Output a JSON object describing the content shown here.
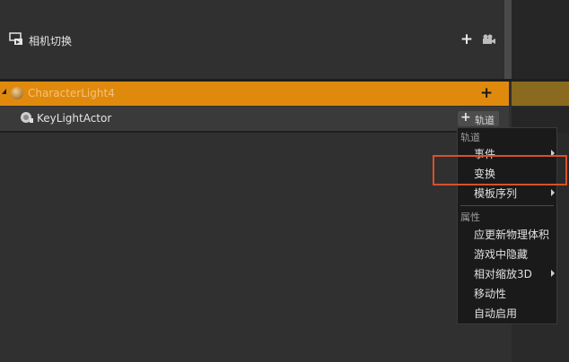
{
  "outliner": {
    "camera_cut": {
      "label": "相机切换",
      "icon": "camera-cut-icon",
      "add_icon": "plus-icon",
      "camera_icon": "video-camera-icon"
    },
    "character_light": {
      "label": "CharacterLight4",
      "icon": "actor-sphere-icon",
      "add_icon": "plus-icon"
    },
    "key_light": {
      "label": "KeyLightActor",
      "icon": "light-bulb-icon",
      "track_button": "轨道"
    }
  },
  "context_menu": {
    "sections": [
      {
        "header": "轨道",
        "items": [
          {
            "label": "事件",
            "submenu": true
          },
          {
            "label": "变换",
            "submenu": false
          },
          {
            "label": "模板序列",
            "submenu": true
          }
        ]
      },
      {
        "header": "属性",
        "items": [
          {
            "label": "应更新物理体积",
            "submenu": false
          },
          {
            "label": "游戏中隐藏",
            "submenu": false
          },
          {
            "label": "相对缩放3D",
            "submenu": true
          },
          {
            "label": "移动性",
            "submenu": false
          },
          {
            "label": "自动启用",
            "submenu": false
          }
        ]
      }
    ]
  },
  "colors": {
    "accent_orange": "#e08a0d",
    "highlight_box": "#d9502a",
    "menu_bg": "#1a1a1a"
  }
}
